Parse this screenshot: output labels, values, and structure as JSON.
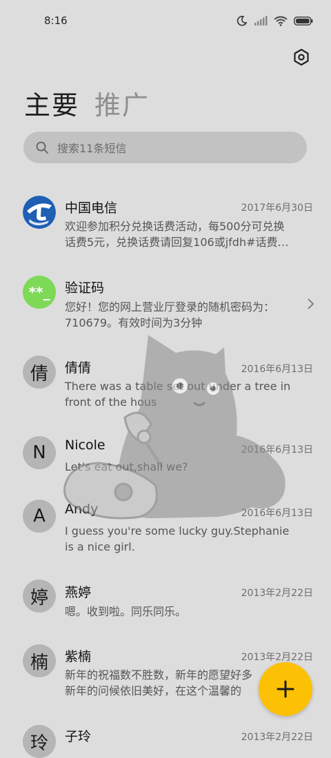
{
  "status": {
    "time": "8:16"
  },
  "tabs": {
    "primary": "主要",
    "promo": "推广"
  },
  "search": {
    "placeholder": "搜索11条短信"
  },
  "messages": [
    {
      "sender": "中国电信",
      "date": "2017年6月30日",
      "line1": "欢迎参加积分兑换话费活动，每500分可兑换",
      "line2": "话费5元，兑换话费请回复106或jfdh#话费…"
    },
    {
      "sender": "验证码",
      "avatar_text": "**_",
      "line1": "您好！您的网上营业厅登录的随机密码为：",
      "line2": "710679。有效时间为3分钟"
    },
    {
      "sender": "倩倩",
      "avatar_text": "倩",
      "date": "2016年6月13日",
      "line1": "There was a table set out under a tree in",
      "line2": "front of the hous"
    },
    {
      "sender": "Nicole",
      "avatar_text": "N",
      "date": "2016年6月13日",
      "line1": "Let's eat out,shall we?"
    },
    {
      "sender": "Andy",
      "avatar_text": "A",
      "date": "2016年6月13日",
      "line1": "I guess you're some lucky guy.Stephanie",
      "line2": "is a nice girl."
    },
    {
      "sender": "燕婷",
      "avatar_text": "婷",
      "date": "2013年2月22日",
      "line1": "嗯。收到啦。同乐同乐。"
    },
    {
      "sender": "紫楠",
      "avatar_text": "楠",
      "date": "2013年2月22日",
      "line1": "新年的祝福数不胜数，新年的愿望好多",
      "line2": "新年的问候依旧美好，在这个温馨的"
    },
    {
      "sender": "子玲",
      "avatar_text": "玲",
      "date": "2013年2月22日"
    }
  ],
  "colors": {
    "fab": "#fcc104",
    "background": "#dddddd",
    "telecom_blue": "#1f5fb4",
    "code_green": "#7ed957"
  }
}
